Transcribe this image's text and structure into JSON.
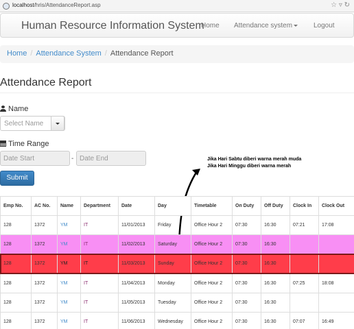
{
  "browser": {
    "url_host": "localhost",
    "url_path": "/hris/AttendanceReport.asp"
  },
  "navbar": {
    "brand": "Human Resource Information System",
    "home": "Home",
    "attendance": "Attendance system",
    "logout": "Logout"
  },
  "breadcrumb": {
    "home": "Home",
    "attendance": "Attendance System",
    "current": "Attendance Report"
  },
  "page": {
    "title": "Attendance Report"
  },
  "form": {
    "name_label": "Name",
    "name_placeholder": "Select Name",
    "range_label": "Time Range",
    "start_placeholder": "Date Start",
    "end_placeholder": "Date End",
    "dash": "-",
    "submit": "Submit"
  },
  "annotation": {
    "line1": "Jika Hari Sabtu diberi warna merah muda",
    "line2": "Jika Hari Minggu diberi warna merah"
  },
  "table": {
    "headers": [
      "Emp No.",
      "AC No.",
      "Name",
      "Department",
      "Date",
      "Day",
      "Timetable",
      "On Duty",
      "Off Duty",
      "Clock In",
      "Clock Out"
    ],
    "rows": [
      [
        "128",
        "1372",
        "YM",
        "IT",
        "11/01/2013",
        "Friday",
        "Office Hour 2",
        "07:30",
        "16:30",
        "07:21",
        "17:08"
      ],
      [
        "128",
        "1372",
        "YM",
        "IT",
        "11/02/2013",
        "Saturday",
        "Office Hour 2",
        "07:30",
        "16:30",
        "",
        ""
      ],
      [
        "128",
        "1372",
        "YM",
        "IT",
        "11/03/2013",
        "Sunday",
        "Office Hour 2",
        "07:30",
        "16:30",
        "",
        ""
      ],
      [
        "128",
        "1372",
        "YM",
        "IT",
        "11/04/2013",
        "Monday",
        "Office Hour 2",
        "07:30",
        "16:30",
        "07:25",
        "18:08"
      ],
      [
        "128",
        "1372",
        "YM",
        "IT",
        "11/05/2013",
        "Tuesday",
        "Office Hour 2",
        "07:30",
        "16:30",
        "",
        ""
      ],
      [
        "128",
        "1372",
        "YM",
        "IT",
        "11/06/2013",
        "Wednesday",
        "Office Hour 2",
        "07:30",
        "16:30",
        "07:07",
        "16:49"
      ]
    ]
  },
  "colors": {
    "saturday_row": "#f88ff4",
    "sunday_row": "#ff3d4a",
    "link": "#428bca",
    "submit": "#428bca"
  }
}
